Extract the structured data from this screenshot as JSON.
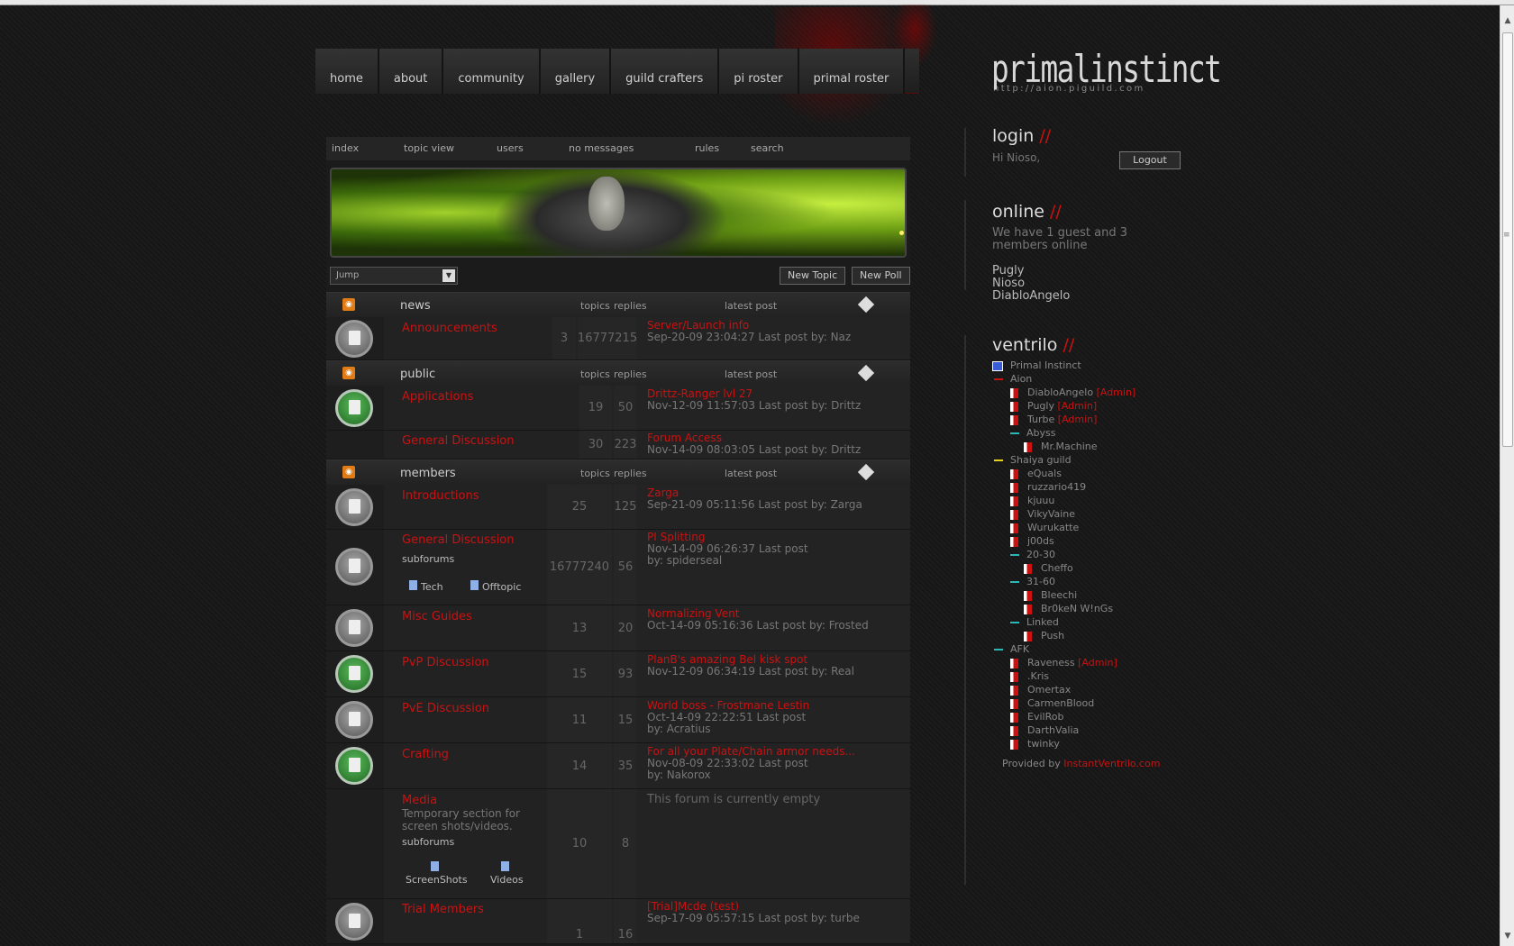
{
  "mainnav": [
    "home",
    "about",
    "community",
    "gallery",
    "guild crafters",
    "pi roster",
    "primal roster"
  ],
  "logo": {
    "name": "primalinstinct",
    "url": "http://aion.piguild.com"
  },
  "subnav": [
    "index",
    "topic view",
    "users",
    "no messages",
    "rules",
    "search"
  ],
  "toolbar": {
    "jump": "Jump",
    "new_topic": "New Topic",
    "new_poll": "New Poll"
  },
  "columns": {
    "topics": "topics",
    "replies": "replies",
    "latest": "latest post"
  },
  "categories": {
    "news": "news",
    "public": "public",
    "members": "members"
  },
  "forums": {
    "announcements": {
      "title": "Announcements",
      "topics": "3",
      "replies": "16777215",
      "lp_title": "Server/Launch info",
      "lp_meta": "Sep-20-09 23:04:27    Last post by: Naz"
    },
    "applications": {
      "title": "Applications",
      "topics": "19",
      "replies": "50",
      "lp_title": "Drittz-Ranger lvl 27",
      "lp_meta": "Nov-12-09 11:57:03    Last post by: Drittz"
    },
    "general_public": {
      "title": "General Discussion",
      "topics": "30",
      "replies": "223",
      "lp_title": "Forum Access",
      "lp_meta": "Nov-14-09 08:03:05    Last post by: Drittz"
    },
    "introductions": {
      "title": "Introductions",
      "topics": "25",
      "replies": "125",
      "lp_title": "Zarga",
      "lp_meta": "Sep-21-09 05:11:56    Last post by: Zarga"
    },
    "general_members": {
      "title": "General Discussion",
      "sublabel": "subforums",
      "sub1": "Tech",
      "sub2": "Offtopic",
      "topics": "16777240",
      "replies": "56",
      "lp_title": "PI Splitting",
      "lp_meta1": "Nov-14-09 06:26:37    Last post",
      "lp_meta2": "by: spiderseal"
    },
    "misc": {
      "title": "Misc Guides",
      "topics": "13",
      "replies": "20",
      "lp_title": "Normalizing Vent",
      "lp_meta": "Oct-14-09 05:16:36    Last post by: Frosted"
    },
    "pvp": {
      "title": "PvP Discussion",
      "topics": "15",
      "replies": "93",
      "lp_title": "PlanB's amazing Bel kisk spot",
      "lp_meta": "Nov-12-09 06:34:19    Last post by: Real"
    },
    "pve": {
      "title": "PvE Discussion",
      "topics": "11",
      "replies": "15",
      "lp_title": "World boss - Frostmane Lestin",
      "lp_meta1": "Oct-14-09 22:22:51    Last post",
      "lp_meta2": "by: Acratius"
    },
    "crafting": {
      "title": "Crafting",
      "topics": "14",
      "replies": "35",
      "lp_title": "For all your Plate/Chain armor needs...",
      "lp_meta1": "Nov-08-09 22:33:02    Last post",
      "lp_meta2": "by: Nakorox"
    },
    "media": {
      "title": "Media",
      "desc": "Temporary section for screen shots/videos.",
      "sublabel": "subforums",
      "sub1": "ScreenShots",
      "sub2": "Videos",
      "topics": "10",
      "replies": "8",
      "empty": "This forum is currently empty"
    },
    "trial": {
      "title": "Trial Members",
      "topics": "1",
      "replies": "16",
      "lp_title": "[Trial]Mcde (test)",
      "lp_meta": "Sep-17-09 05:57:15    Last post by: turbe"
    }
  },
  "login": {
    "title": "login",
    "slashes": "//",
    "greeting": "Hi Nioso,",
    "logout": "Logout"
  },
  "online": {
    "title": "online",
    "slashes": "//",
    "text": "We have 1 guest and 3 members online",
    "members": [
      "Pugly",
      "Nioso",
      "DiabloAngelo"
    ]
  },
  "ventrilo": {
    "title": "ventrilo",
    "slashes": "//",
    "server": "Primal Instinct",
    "items": [
      "Aion",
      "DiabloAngelo",
      "[Admin]",
      "Pugly",
      "[Admin]",
      "Turbe",
      "[Admin]",
      "Abyss",
      "Mr.Machine",
      "Shaiya guild",
      "eQuals",
      "ruzzario419",
      "kjuuu",
      "VikyVaine",
      "Wurukatte",
      "j00ds",
      "20-30",
      "Cheffo",
      "31-60",
      "Bleechi",
      "Br0keN W!nGs",
      "Linked",
      "Push",
      "AFK",
      "Raveness",
      "[Admin]",
      ".Kris",
      "Omertax",
      "CarmenBlood",
      "EvilRob",
      "DarthValia",
      "twinky"
    ],
    "provided_by": "Provided by",
    "provider": "InstantVentrilo.com"
  },
  "colors": {
    "accent": "#cc1111",
    "rss": "#e07b16",
    "banner": "#8fc41f"
  }
}
